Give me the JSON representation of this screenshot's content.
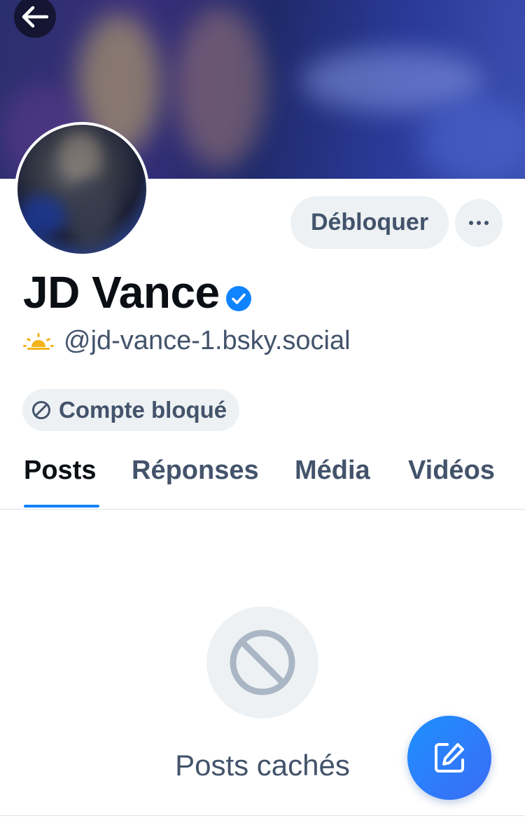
{
  "profile": {
    "display_name": "JD Vance",
    "handle": "@jd-vance-1.bsky.social",
    "verified": true
  },
  "actions": {
    "unblock_label": "Débloquer",
    "more_icon": "ellipsis-icon"
  },
  "badge": {
    "blocked_label": "Compte bloqué",
    "icon": "blocked-icon"
  },
  "tabs": [
    {
      "label": "Posts",
      "active": true
    },
    {
      "label": "Réponses",
      "active": false
    },
    {
      "label": "Média",
      "active": false
    },
    {
      "label": "Vidéos",
      "active": false
    }
  ],
  "empty_state": {
    "message": "Posts cachés",
    "icon": "prohibited-icon"
  },
  "fab": {
    "icon": "compose-icon"
  },
  "colors": {
    "accent": "#1083fe",
    "verified": "#1083fe",
    "secondary_text": "#43536b",
    "chip_background": "#edf1f4"
  }
}
